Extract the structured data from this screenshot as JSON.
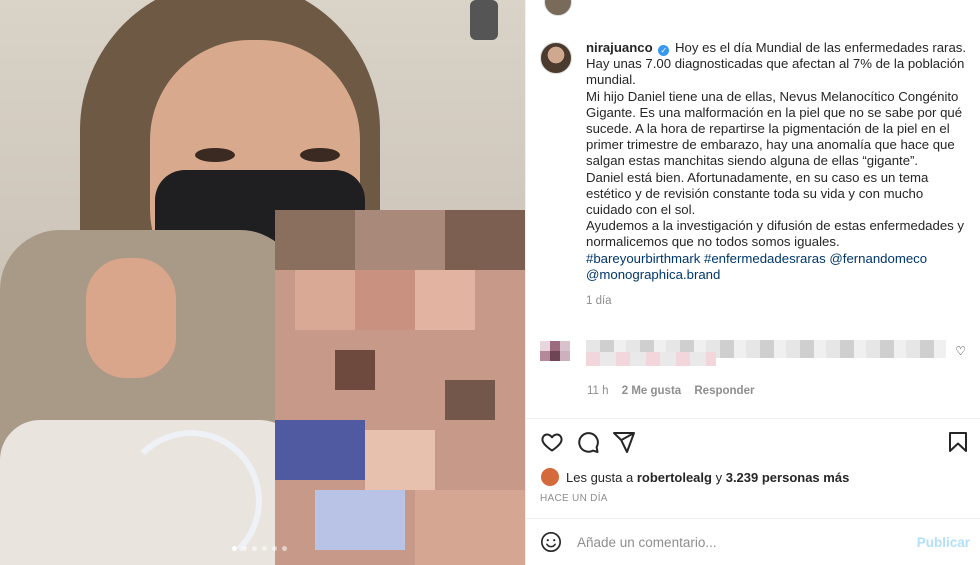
{
  "post": {
    "username": "nirajuanco",
    "caption": {
      "l1": "Hoy es el día Mundial de las enfermedades raras.",
      "l2": "Hay unas 7.00 diagnosticadas que afectan al 7% de la población mundial.",
      "l3": "Mi hijo Daniel tiene una de ellas, Nevus Melanocítico Congénito Gigante. Es una malformación en la piel que no se sabe por qué sucede. A la hora de repartirse la pigmentación de la piel en el primer trimestre de embarazo, hay una anomalía que hace que salgan estas manchitas siendo alguna de ellas “gigante”.",
      "l4": "Daniel está bien. Afortunadamente, en su caso es un tema estético y de revisión constante toda su vida y con mucho cuidado con el sol.",
      "l5": "Ayudemos a la investigación y difusión de estas enfermedades y normalicemos que no todos somos iguales.",
      "tags": [
        "#bareyourbirthmark",
        "#enfermedadesraras",
        "@fernandomeco",
        "@monographica.brand"
      ]
    },
    "age": "1 día"
  },
  "comment": {
    "time": "11 h",
    "likes": "2 Me gusta",
    "reply": "Responder"
  },
  "actions": {
    "like_icon": "heart-icon",
    "comment_icon": "comment-icon",
    "share_icon": "paper-plane-icon",
    "save_icon": "bookmark-icon"
  },
  "likes_line": {
    "prefix": "Les gusta a",
    "user": "robertolealg",
    "middle": "y",
    "count": "3.239 personas más"
  },
  "timestamp": "HACE UN DÍA",
  "add_comment": {
    "placeholder": "Añade un comentario...",
    "publish": "Publicar"
  },
  "carousel": {
    "count": 6,
    "active": 0
  },
  "colors": {
    "link": "#00376b",
    "muted": "#8e8e8e",
    "publish": "#b2dffc",
    "verified": "#3897f0"
  }
}
